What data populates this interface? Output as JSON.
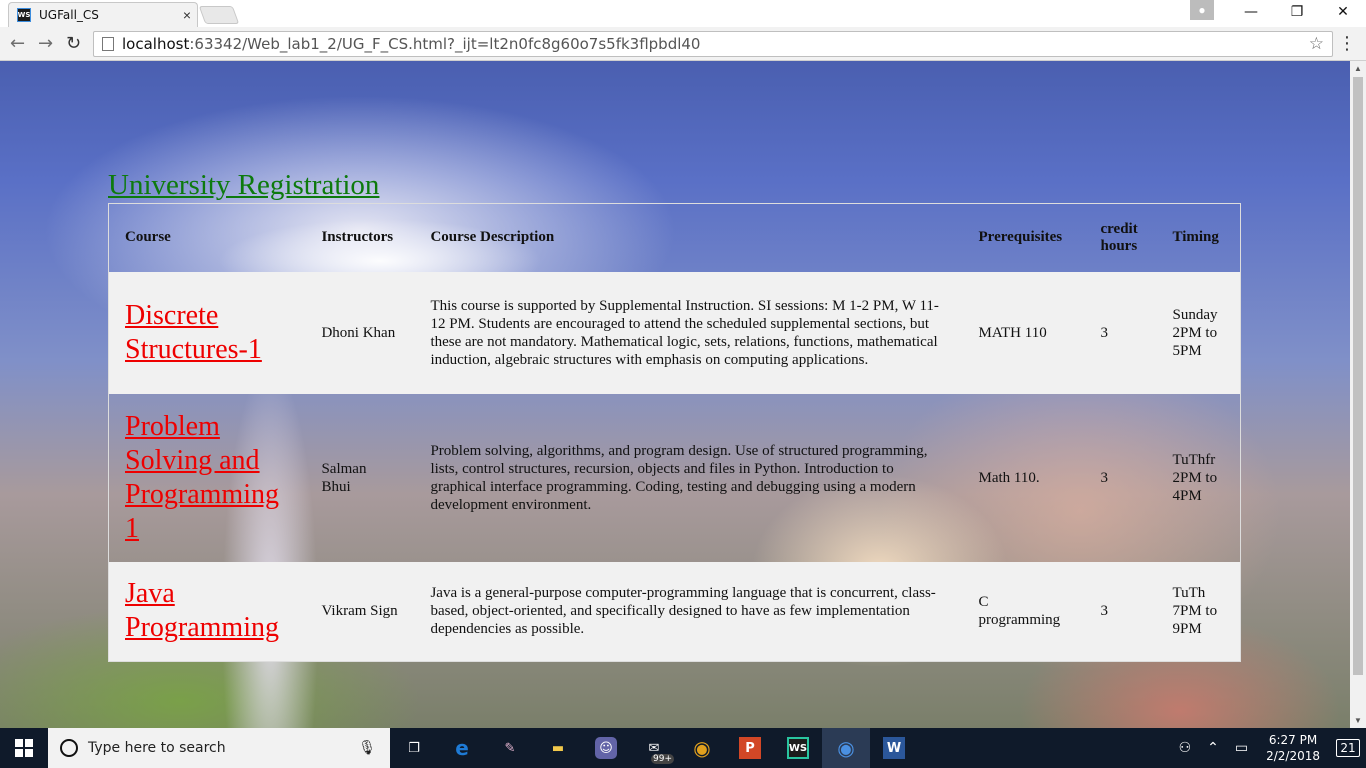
{
  "browser": {
    "tab_title": "UGFall_CS",
    "tab_favicon": "WS",
    "tab_close": "×",
    "url_host": "localhost",
    "url_rest": ":63342/Web_lab1_2/UG_F_CS.html?_ijt=lt2n0fc8g60o7s5fk3flpbdl40",
    "back_glyph": "←",
    "forward_glyph": "→",
    "reload_glyph": "↻",
    "star_glyph": "☆",
    "menu_glyph": "⋮",
    "minimize_glyph": "—",
    "maximize_glyph": "❐",
    "close_glyph": "✕",
    "user_glyph": "👤"
  },
  "page": {
    "title": "University Registration",
    "headers": {
      "course": "Course",
      "instructors": "Instructors",
      "description": "Course Description",
      "prerequisites": "Prerequisites",
      "credit": "credit hours",
      "timing": "Timing"
    },
    "rows": [
      {
        "course": "Discrete Structures-1",
        "instructor": "Dhoni Khan",
        "description": "This course is supported by Supplemental Instruction. SI sessions: M 1-2 PM, W 11-12 PM. Students are encouraged to attend the scheduled supplemental sections, but these are not mandatory. Mathematical logic, sets, relations, functions, mathematical induction, algebraic structures with emphasis on computing applications.",
        "prerequisites": "MATH 110",
        "credit": "3",
        "timing": "Sunday 2PM to 5PM"
      },
      {
        "course": "Problem Solving and Programming 1",
        "instructor": "Salman Bhui",
        "description": "Problem solving, algorithms, and program design. Use of structured programming, lists, control structures, recursion, objects and files in Python. Introduction to graphical interface programming. Coding, testing and debugging using a modern development environment.",
        "prerequisites": "Math 110.",
        "credit": "3",
        "timing": "TuThfr 2PM to 4PM"
      },
      {
        "course": "Java Programming",
        "instructor": "Vikram Sign",
        "description": "Java is a general-purpose computer-programming language that is concurrent, class-based, object-oriented, and specifically designed to have as few implementation dependencies as possible.",
        "prerequisites": "C programming",
        "credit": "3",
        "timing": "TuTh 7PM to 9PM"
      }
    ]
  },
  "taskbar": {
    "search_placeholder": "Type here to search",
    "mail_badge": "99+",
    "time": "6:27 PM",
    "date": "2/2/2018",
    "notification_count": "21",
    "apps": [
      {
        "name": "task-view-icon",
        "glyph": "❐"
      },
      {
        "name": "edge-icon",
        "glyph": "e"
      },
      {
        "name": "paint-icon",
        "glyph": "✎"
      },
      {
        "name": "file-explorer-icon",
        "glyph": "▬"
      },
      {
        "name": "teams-icon",
        "glyph": "☺"
      },
      {
        "name": "mail-icon",
        "glyph": "✉"
      },
      {
        "name": "chrome-icon",
        "glyph": "◉"
      },
      {
        "name": "powerpoint-icon",
        "glyph": "P"
      },
      {
        "name": "webstorm-icon",
        "glyph": "WS"
      },
      {
        "name": "chrome-active-icon",
        "glyph": "◉"
      },
      {
        "name": "word-icon",
        "glyph": "W"
      }
    ],
    "colors": {
      "edge": "#1e7bd6",
      "chrome": "#e0a01e",
      "powerpoint": "#d24726",
      "webstorm": "#1c1c1c",
      "word": "#2b579a",
      "file_explorer": "#f2c94c",
      "teams": "#6264a7"
    }
  },
  "colors": {
    "title_link": "#0d7a0d",
    "course_link": "#ee0000",
    "row_light": "#f1f1f1"
  }
}
